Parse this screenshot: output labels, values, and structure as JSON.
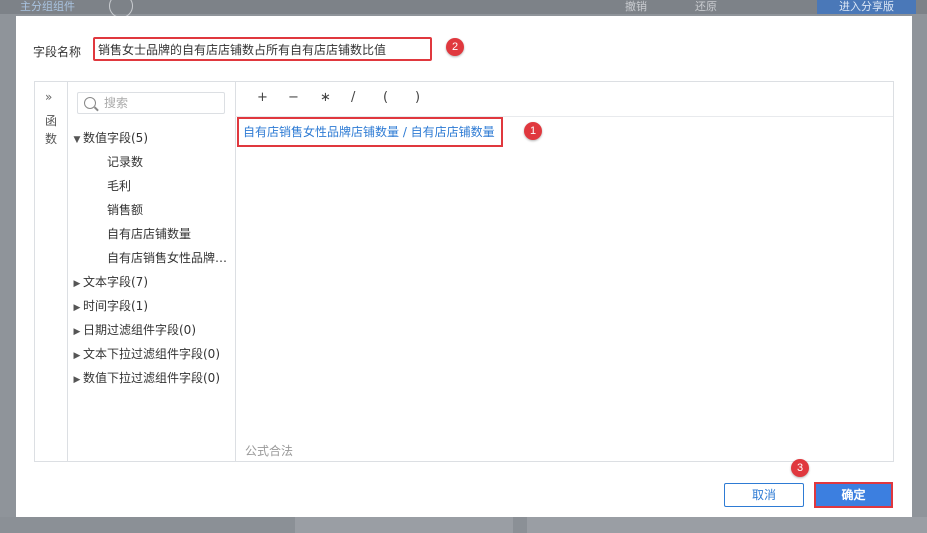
{
  "background": {
    "top_left_text": "主分组组件",
    "top_mid_text_1": "撤销",
    "top_mid_text_2": "还原",
    "top_right_button": "进入分享版"
  },
  "dialog": {
    "field_name_label": "字段名称",
    "field_name_value": "销售女士品牌的自有店店铺数占所有自有店店铺数比值",
    "func_toggle_chevron": "»",
    "func_toggle_label": "函数",
    "search_placeholder": "搜索",
    "tree": [
      {
        "label": "数值字段(5)",
        "expanded": true
      },
      {
        "label": "记录数",
        "child": true
      },
      {
        "label": "毛利",
        "child": true
      },
      {
        "label": "销售额",
        "child": true
      },
      {
        "label": "自有店店铺数量",
        "child": true
      },
      {
        "label": "自有店销售女性品牌…",
        "child": true
      },
      {
        "label": "文本字段(7)",
        "expanded": false
      },
      {
        "label": "时间字段(1)",
        "expanded": false
      },
      {
        "label": "日期过滤组件字段(0)",
        "expanded": false
      },
      {
        "label": "文本下拉过滤组件字段(0)",
        "expanded": false
      },
      {
        "label": "数值下拉过滤组件字段(0)",
        "expanded": false
      }
    ],
    "operators": [
      "+",
      "−",
      "∗",
      "/",
      "(",
      ")"
    ],
    "formula": "自有店销售女性品牌店铺数量 / 自有店店铺数量",
    "validity": "公式合法",
    "cancel_label": "取消",
    "ok_label": "确定"
  },
  "markers": [
    "1",
    "2",
    "3"
  ],
  "colors": {
    "accent": "#3c7fe0",
    "link": "#2e7bd4",
    "highlight": "#e0383e"
  }
}
